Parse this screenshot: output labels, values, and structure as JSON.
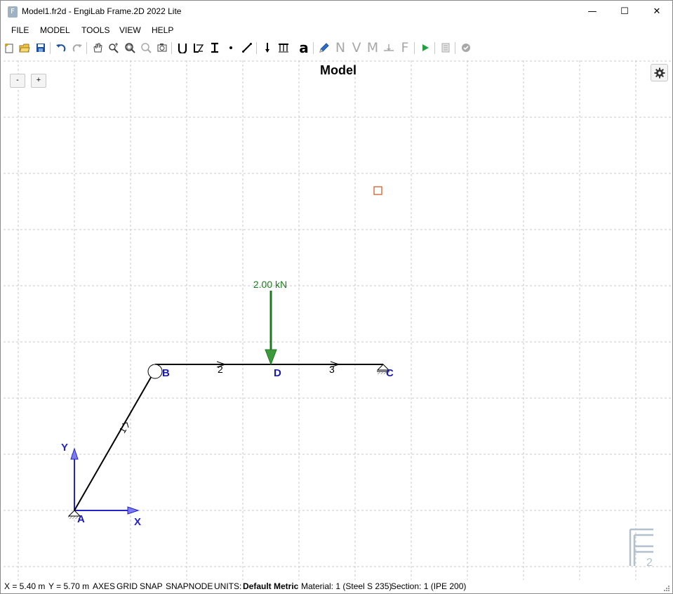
{
  "window": {
    "title": "Model1.fr2d - EngiLab Frame.2D 2022 Lite",
    "app_icon_letter": "F",
    "minimize_glyph": "—",
    "maximize_glyph": "☐",
    "close_glyph": "✕"
  },
  "menu": {
    "items": [
      "FILE",
      "MODEL",
      "TOOLS",
      "VIEW",
      "HELP"
    ]
  },
  "toolbar": {
    "results_N": "N",
    "results_V": "V",
    "results_M": "M",
    "results_F": "F",
    "text_tool": "a"
  },
  "canvas": {
    "title": "Model",
    "zoom_out": "-",
    "zoom_in": "+",
    "load_label": "2.00 kN",
    "nodes": {
      "A": "A",
      "B": "B",
      "C": "C",
      "D": "D"
    },
    "elements": {
      "e1": "1",
      "e2": "2",
      "e3": "3"
    },
    "axes": {
      "x": "X",
      "y": "Y"
    },
    "watermark": "2"
  },
  "colors": {
    "node_label": "#1a1aa8",
    "axis": "#2424c8",
    "load": "#1b7a1b",
    "load_fill": "#3c9a3c",
    "grid": "#c8c8c8",
    "disabled": "#a8a8a8"
  },
  "status": {
    "x": "X = 5.40 m",
    "y": "Y = 5.70 m",
    "axes": "AXES",
    "grid": "GRID",
    "snap": "SNAP",
    "snapnode": "SNAPNODE",
    "units_prefix": "UNITS:",
    "units_value": "Default Metric",
    "material": "Material: 1 (Steel S 235)",
    "section": "Section: 1 (IPE 200)"
  }
}
